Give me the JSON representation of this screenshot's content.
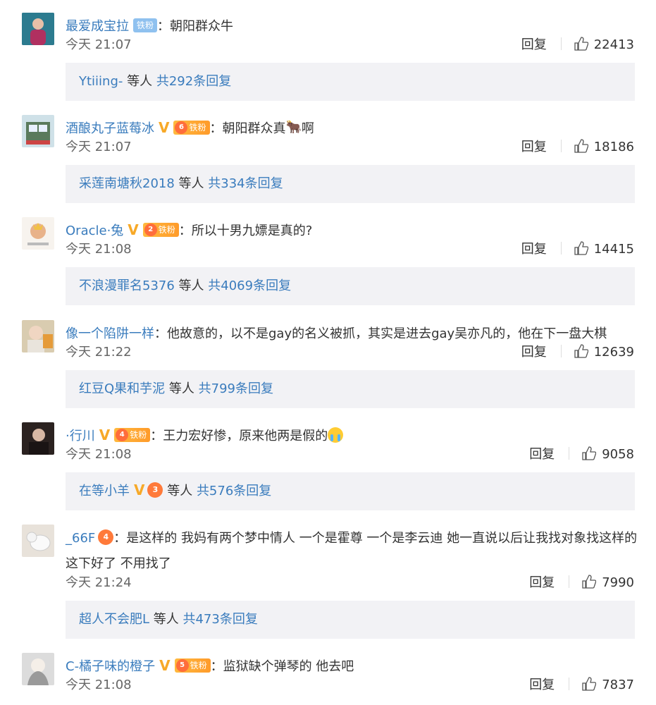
{
  "comments": [
    {
      "user": "最爱成宝拉",
      "badge": "铁粉",
      "content": "：朝阳群众牛",
      "time": "今天 21:07",
      "reply_label": "回复",
      "likes": "22413",
      "thread": {
        "name": "Ytiiing-",
        "mid": " 等人 ",
        "count": "共292条回复"
      }
    },
    {
      "user": "酒酿丸子蓝莓冰",
      "badge_level": "6",
      "badge": "铁粉",
      "content": "：朝阳群众真",
      "content_tail": "啊",
      "time": "今天 21:07",
      "reply_label": "回复",
      "likes": "18186",
      "thread": {
        "name": "采莲南塘秋2018",
        "mid": " 等人 ",
        "count": "共334条回复"
      }
    },
    {
      "user": "Oracle·兔",
      "badge_level": "2",
      "badge": "铁粉",
      "content": "：所以十男九嫖是真的?",
      "time": "今天 21:08",
      "reply_label": "回复",
      "likes": "14415",
      "thread": {
        "name": "不浪漫罪名5376",
        "mid": " 等人 ",
        "count": "共4069条回复"
      }
    },
    {
      "user": "像一个陷阱一样",
      "content": "：他故意的，以不是gay的名义被抓，其实是进去gay吴亦凡的，他在下一盘大棋",
      "time": "今天 21:22",
      "reply_label": "回复",
      "likes": "12639",
      "thread": {
        "name": "红豆Q果和芋泥",
        "mid": " 等人 ",
        "count": "共799条回复"
      }
    },
    {
      "user": "·行川",
      "badge_level": "4",
      "badge": "铁粉",
      "content": "：王力宏好惨，原来他两是假的",
      "time": "今天 21:08",
      "reply_label": "回复",
      "likes": "9058",
      "thread": {
        "name": "在等小羊",
        "crown_level": "3",
        "mid": " 等人 ",
        "count": "共576条回复"
      }
    },
    {
      "user": "_66F",
      "crown_level": "4",
      "content": "：是这样的 我妈有两个梦中情人 一个是霍尊 一个是李云迪 她一直说以后让我找对象找这样的 这下好了 不用找了",
      "time": "今天 21:24",
      "reply_label": "回复",
      "likes": "7990",
      "thread": {
        "name": "超人不会肥L",
        "mid": " 等人 ",
        "count": "共473条回复"
      }
    },
    {
      "user": "C-橘子味的橙子",
      "badge_level": "5",
      "badge": "铁粉",
      "content": "：监狱缺个弹琴的 他去吧",
      "time": "今天 21:08",
      "reply_label": "回复",
      "likes": "7837"
    }
  ],
  "colors": {
    "link": "#3a7cbd",
    "verified": "#f7a928",
    "thread_bg": "#f2f2f5"
  },
  "icons": {
    "like": "thumbs-up-icon",
    "verified": "verified-v-icon",
    "fan_badge": "crown-icon"
  }
}
